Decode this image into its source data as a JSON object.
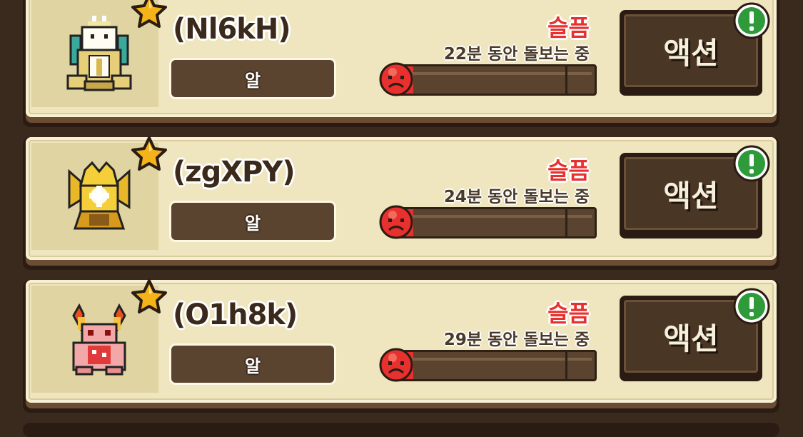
{
  "pets": [
    {
      "name": "(Nl6kH)",
      "stage": "알",
      "mood": "슬픔",
      "care_time": "22분 동안 돌보는 중",
      "mood_level": 0.08,
      "action_label": "액션",
      "sprite": "golden-angel-sprite",
      "colors": {
        "main": "#e8d070",
        "accent": "#ffffff"
      }
    },
    {
      "name": "(zgXPY)",
      "stage": "알",
      "mood": "슬픔",
      "care_time": "24분 동안 돌보는 중",
      "mood_level": 0.08,
      "action_label": "액션",
      "sprite": "golden-crown-sprite",
      "colors": {
        "main": "#e9b72a",
        "accent": "#fff6c0"
      }
    },
    {
      "name": "(O1h8k)",
      "stage": "알",
      "mood": "슬픔",
      "care_time": "29분 동안 돌보는 중",
      "mood_level": 0.08,
      "action_label": "액션",
      "sprite": "fire-demon-sprite",
      "colors": {
        "main": "#f0a0a0",
        "accent": "#e85020"
      }
    }
  ],
  "theme": {
    "mood_sad_color": "#e8312e",
    "alert_color": "#2e9a3a",
    "star_color": "#f5b31a"
  }
}
